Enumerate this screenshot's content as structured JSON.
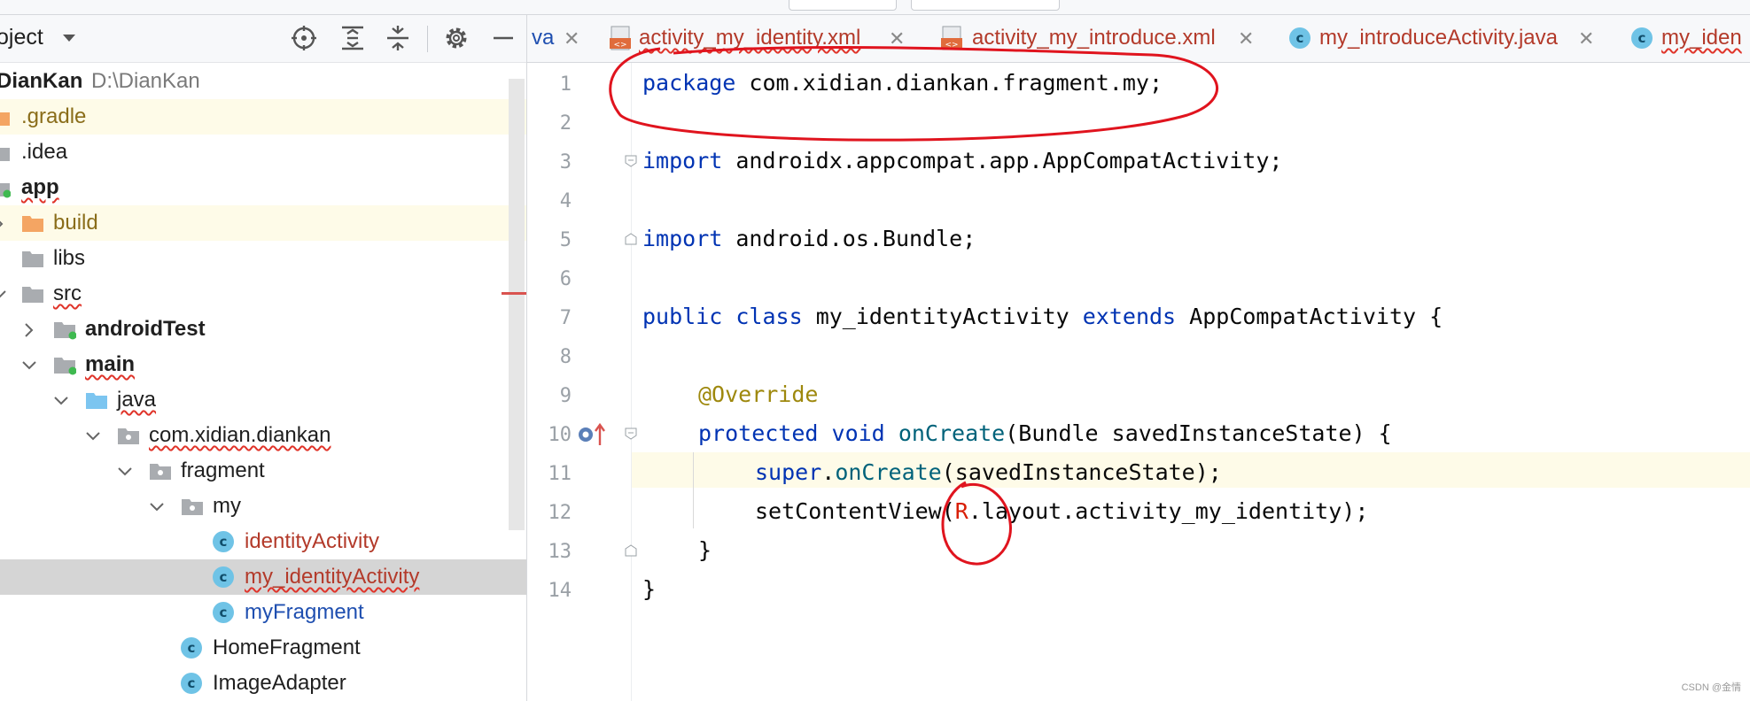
{
  "project_panel": {
    "title": "oject",
    "root": {
      "name": "DianKan",
      "path": "D:\\DianKan"
    },
    "items": [
      {
        "label": ".gradle"
      },
      {
        "label": ".idea"
      },
      {
        "label": "app"
      },
      {
        "label": "build"
      },
      {
        "label": "libs"
      },
      {
        "label": "src"
      },
      {
        "label": "androidTest"
      },
      {
        "label": "main"
      },
      {
        "label": "java"
      },
      {
        "label": "com.xidian.diankan"
      },
      {
        "label": "fragment"
      },
      {
        "label": "my"
      },
      {
        "label": "identityActivity"
      },
      {
        "label": "my_identityActivity"
      },
      {
        "label": "myFragment"
      },
      {
        "label": "HomeFragment"
      },
      {
        "label": "ImageAdapter"
      }
    ]
  },
  "tabs": [
    {
      "label": "va"
    },
    {
      "label": "activity_my_identity.xml"
    },
    {
      "label": "activity_my_introduce.xml"
    },
    {
      "label": "my_introduceActivity.java"
    },
    {
      "label": "my_iden"
    }
  ],
  "editor": {
    "line_numbers": [
      "1",
      "2",
      "3",
      "4",
      "5",
      "6",
      "7",
      "8",
      "9",
      "10",
      "11",
      "12",
      "13",
      "14"
    ],
    "lines": [
      {
        "kw": "package",
        "rest": " com.xidian.diankan.fragment.my;"
      },
      {
        "text": ""
      },
      {
        "kw": "import",
        "rest": " androidx.appcompat.app.AppCompatActivity;"
      },
      {
        "text": ""
      },
      {
        "kw": "import",
        "rest": " android.os.Bundle;"
      },
      {
        "text": ""
      },
      {
        "kw1": "public",
        "kw2": "class",
        "name": "my_identityActivity",
        "kw3": "extends",
        "rest": "AppCompatActivity {"
      },
      {
        "text": ""
      },
      {
        "annotation": "@Override"
      },
      {
        "kw1": "protected",
        "kw2": "void",
        "fn": "onCreate",
        "rest": "(Bundle savedInstanceState) {"
      },
      {
        "kw": "super",
        "fn": "onCreate",
        "rest": "(savedInstanceState);"
      },
      {
        "fn_plain": "setContentView(",
        "rref": "R",
        "rest": ".layout.activity_my_identity);"
      },
      {
        "text": "}"
      },
      {
        "text": "}"
      }
    ]
  },
  "watermark": "CSDN @金情",
  "colors": {
    "keyword": "#0033b3",
    "annotation": "#9e880d",
    "method": "#00627a",
    "class_file": "#b33a2a",
    "active_tab": "#3574f0",
    "highlight_annotation": "#e0141e"
  }
}
